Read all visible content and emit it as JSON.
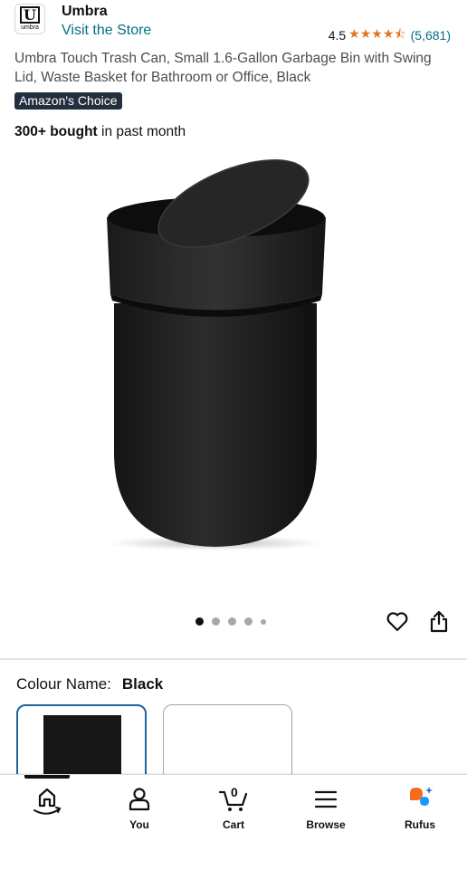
{
  "header": {
    "brand_logo_text": "umbra",
    "brand_logo_letter": "U",
    "brand_name": "Umbra",
    "visit_store": "Visit the Store",
    "rating_value": "4.5",
    "stars": "★★★★⯪",
    "rating_count": "(5,681)"
  },
  "product": {
    "title": "Umbra Touch Trash Can, Small 1.6-Gallon Garbage Bin with Swing Lid, Waste Basket for Bathroom or Office, Black",
    "badge": "Amazon's Choice",
    "bought_bold": "300+ bought",
    "bought_rest": " in past month",
    "image_count": 5,
    "active_image": 1
  },
  "colour": {
    "label": "Colour Name:",
    "value": "Black"
  },
  "bottom_nav": [
    {
      "label": "",
      "icon": "home-icon"
    },
    {
      "label": "You",
      "icon": "user-icon"
    },
    {
      "label": "Cart",
      "icon": "cart-icon",
      "count": "0"
    },
    {
      "label": "Browse",
      "icon": "menu-icon"
    },
    {
      "label": "Rufus",
      "icon": "rufus-icon"
    }
  ],
  "colors": {
    "link": "#007185",
    "star": "#de7921",
    "badge_bg": "#232f3e",
    "selected_border": "#2162a1",
    "rufus_orange": "#f76b1c",
    "rufus_blue": "#1a98ff"
  }
}
